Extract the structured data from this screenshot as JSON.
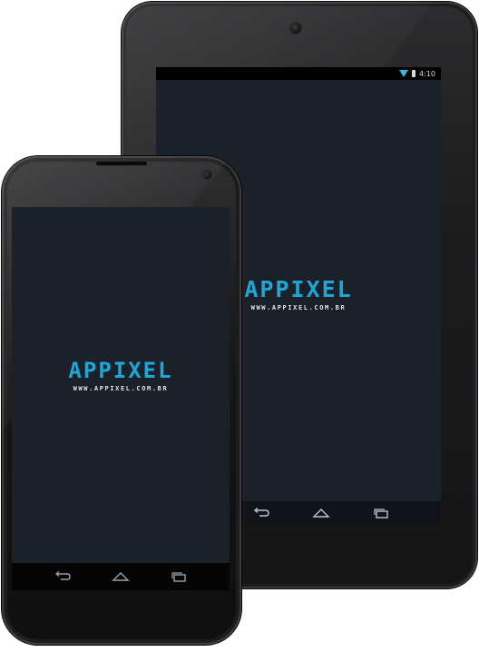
{
  "tablet": {
    "status_time": "4:10",
    "brand": "APPIXEL",
    "url": "WWW.APPIXEL.COM.BR",
    "navbar": [
      "back-icon",
      "home-icon",
      "recent-apps-icon"
    ]
  },
  "phone": {
    "brand": "APPIXEL",
    "url": "WWW.APPIXEL.COM.BR",
    "navbar": [
      "back-icon",
      "home-icon",
      "recent-apps-icon"
    ]
  },
  "colors": {
    "brand_accent": "#1ca7d6",
    "screen_background": "#1b2029",
    "device_body": "#1b1b1c"
  }
}
